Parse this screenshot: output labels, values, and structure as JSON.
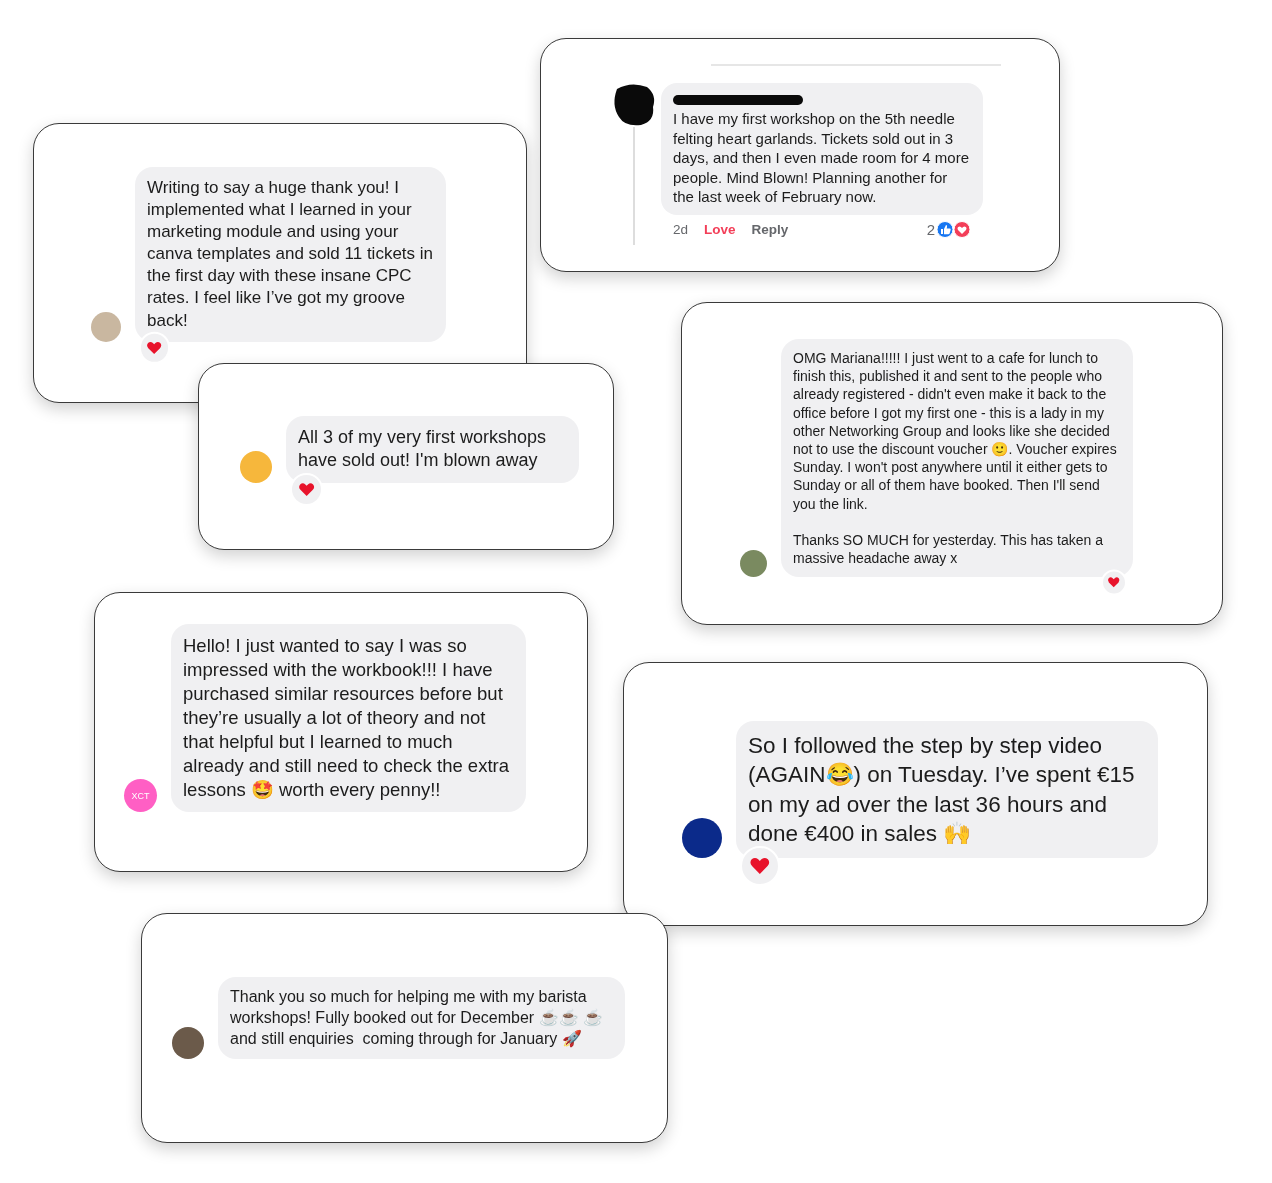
{
  "cards": [
    {
      "kind": "facebook",
      "text": "I have my first workshop on the 5th needle felting heart garlands. Tickets sold out in 3 days, and then I even made room for 4 more people. Mind Blown! Planning another for the last week of February now.",
      "name_redacted": true,
      "time": "2d",
      "actions": [
        {
          "label": "Love",
          "selected": true
        },
        {
          "label": "Reply",
          "selected": false
        }
      ],
      "reaction_count": "2"
    },
    {
      "kind": "message",
      "text": "Writing to say a huge thank you! I implemented what I learned in your marketing module and using your canva templates and sold 11 tickets in the first day with these insane CPC rates. I feel like I’ve got my groove back!",
      "reacted": true
    },
    {
      "kind": "message",
      "text": "All 3 of my very first workshops have sold out! I'm blown away",
      "reacted": true
    },
    {
      "kind": "message",
      "text": "OMG Mariana!!!!! I just went to a cafe for lunch to finish this, published it and sent to the people who already registered - didn't even make it back to the office before I got my first one - this is a lady in my other Networking Group and looks like she decided not to use the discount voucher 🙂. Voucher expires Sunday. I won't post anywhere until it either gets to Sunday or all of them have booked. Then I'll send you the link.\n\nThanks SO MUCH for yesterday. This has taken a massive headache away x",
      "reacted": true
    },
    {
      "kind": "message",
      "text": "Hello! I just wanted to say I was so impressed with the workbook!!! I have purchased similar resources before but they’re usually a lot of theory and not that helpful but I learned to much already and still need to check the extra lessons 🤩 worth every penny!!",
      "avatar_text": "XCT",
      "reacted": false
    },
    {
      "kind": "message",
      "text": "So I followed the step by step video (AGAIN😂) on Tuesday. I’ve spent €15 on my ad over the last 36 hours and done €400 in sales 🙌",
      "reacted": true
    },
    {
      "kind": "message",
      "text": "Thank you so much for helping me with my barista workshops! Fully booked out for December ☕☕ ☕ and still enquiries  coming through for January 🚀",
      "reacted": false
    }
  ]
}
